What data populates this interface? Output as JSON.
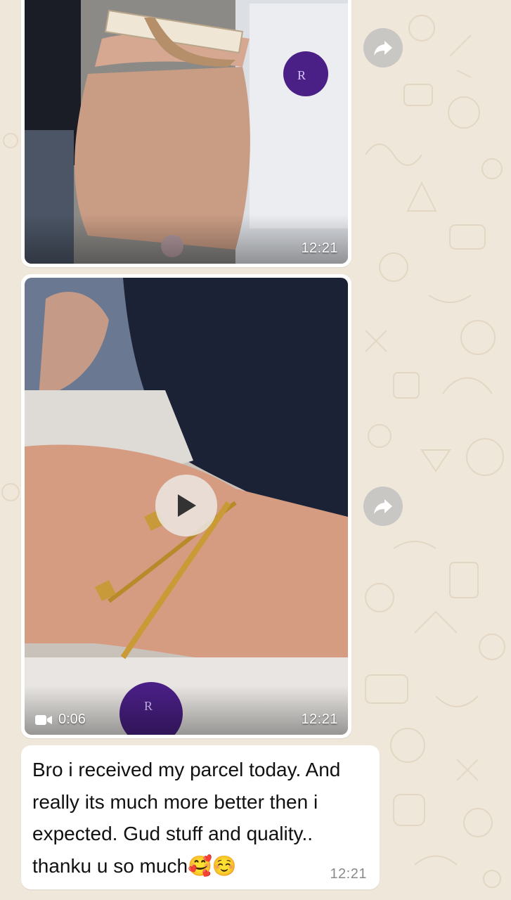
{
  "chat": {
    "background_color": "#efe7da",
    "messages": [
      {
        "type": "image",
        "timestamp": "12:21",
        "image_icon": "photo-of-wrist-with-cuff-bracelet"
      },
      {
        "type": "video",
        "timestamp": "12:21",
        "duration": "0:06",
        "duration_icon": "video-camera-icon",
        "play_icon": "play-icon",
        "image_icon": "video-thumbnail-wrist-with-gold-bracelets"
      },
      {
        "type": "text",
        "text": "Bro i received my parcel today. And really its much more better then i expected. Gud stuff and quality.. thanku u so much🥰☺️",
        "timestamp": "12:21"
      }
    ],
    "forward_icon": "forward-arrow-icon",
    "accent_colors": {
      "bubble": "#ffffff",
      "forward_button": "#c9c7c3",
      "timestamp_text": "#8a8a8a"
    }
  }
}
